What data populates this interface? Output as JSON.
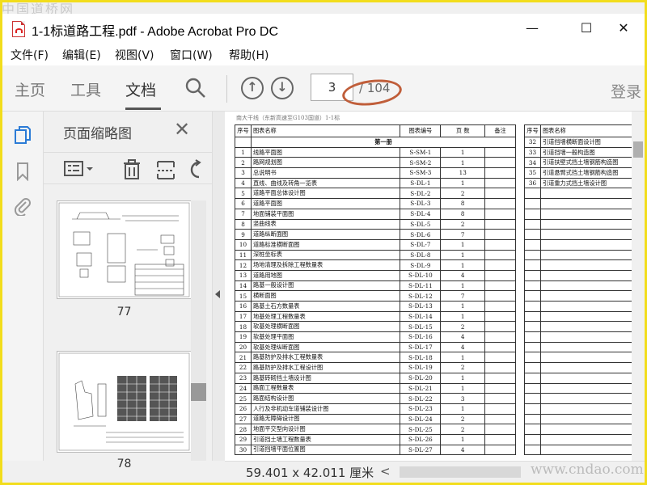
{
  "watermarks": {
    "top": "中国道桥网",
    "bottom": "www.cndao.com"
  },
  "window": {
    "title": "1-1标道路工程.pdf - Adobe Acrobat Pro DC",
    "minimize": "—",
    "maximize": "☐",
    "close": "✕"
  },
  "menu": [
    "文件(F)",
    "编辑(E)",
    "视图(V)",
    "窗口(W)",
    "帮助(H)"
  ],
  "toolbar": {
    "tabs": [
      "主页",
      "工具",
      "文档"
    ],
    "active_tab": "文档",
    "page_current": "3",
    "page_total": "/ 104",
    "login": "登录",
    "prev_icon": "arrow-up-icon",
    "next_icon": "arrow-down-icon",
    "search_icon": "search-icon"
  },
  "thumbnail_panel": {
    "title": "页面缩略图",
    "pages": [
      "77",
      "78"
    ]
  },
  "document": {
    "header": "南大干线（东新高速至G103国道）1-1标",
    "left_table": {
      "headers": [
        "序号",
        "图表名称",
        "图表编号",
        "页  数",
        "备注"
      ],
      "section": "第一册",
      "rows": [
        [
          "1",
          "线路平面图",
          "S-SM-1",
          "1",
          ""
        ],
        [
          "2",
          "路网规划图",
          "S-SM-2",
          "1",
          ""
        ],
        [
          "3",
          "总说明书",
          "S-SM-3",
          "13",
          ""
        ],
        [
          "4",
          "直线、曲线及转角一览表",
          "S-DL-1",
          "1",
          ""
        ],
        [
          "5",
          "道路平面总体设计图",
          "S-DL-2",
          "2",
          ""
        ],
        [
          "6",
          "道路平面图",
          "S-DL-3",
          "8",
          ""
        ],
        [
          "7",
          "地面铺装平面图",
          "S-DL-4",
          "8",
          ""
        ],
        [
          "8",
          "竖曲线表",
          "S-DL-5",
          "2",
          ""
        ],
        [
          "9",
          "道路纵断面图",
          "S-DL-6",
          "7",
          ""
        ],
        [
          "10",
          "道路标准横断面图",
          "S-DL-7",
          "1",
          ""
        ],
        [
          "11",
          "深桩坐标表",
          "S-DL-8",
          "1",
          ""
        ],
        [
          "12",
          "场地清理及拆除工程数量表",
          "S-DL-9",
          "1",
          ""
        ],
        [
          "13",
          "道路用地图",
          "S-DL-10",
          "4",
          ""
        ],
        [
          "14",
          "路基一般设计图",
          "S-DL-11",
          "1",
          ""
        ],
        [
          "15",
          "横断面图",
          "S-DL-12",
          "7",
          ""
        ],
        [
          "16",
          "路基土石方数量表",
          "S-DL-13",
          "1",
          ""
        ],
        [
          "17",
          "地基处理工程数量表",
          "S-DL-14",
          "1",
          ""
        ],
        [
          "18",
          "软基处理横断面图",
          "S-DL-15",
          "2",
          ""
        ],
        [
          "19",
          "软基处理平面图",
          "S-DL-16",
          "4",
          ""
        ],
        [
          "20",
          "软基处理纵断面图",
          "S-DL-17",
          "4",
          ""
        ],
        [
          "21",
          "路基防护及排水工程数量表",
          "S-DL-18",
          "1",
          ""
        ],
        [
          "22",
          "路基防护及排水工程设计图",
          "S-DL-19",
          "2",
          ""
        ],
        [
          "23",
          "路基砖砌挡土墙设计图",
          "S-DL-20",
          "1",
          ""
        ],
        [
          "24",
          "路面工程数量表",
          "S-DL-21",
          "1",
          ""
        ],
        [
          "25",
          "路面结构设计图",
          "S-DL-22",
          "3",
          ""
        ],
        [
          "26",
          "人行及非机动车道铺装设计图",
          "S-DL-23",
          "1",
          ""
        ],
        [
          "27",
          "道路无障碍设计图",
          "S-DL-24",
          "2",
          ""
        ],
        [
          "28",
          "地面平交型向设计图",
          "S-DL-25",
          "2",
          ""
        ],
        [
          "29",
          "引道挡土墙工程数量表",
          "S-DL-26",
          "1",
          ""
        ],
        [
          "30",
          "引道挡墙平面位置图",
          "S-DL-27",
          "4",
          ""
        ]
      ]
    },
    "right_table": {
      "headers": [
        "序号",
        "图表名称"
      ],
      "rows": [
        [
          "32",
          "引道挡墙横断面设计图"
        ],
        [
          "33",
          "引道挡墙一般构造图"
        ],
        [
          "34",
          "引道扶壁式挡土墙钢筋构造图"
        ],
        [
          "35",
          "引道悬臂式挡土墙钢筋构造图"
        ],
        [
          "36",
          "引道重力式挡土墙设计图"
        ]
      ]
    }
  },
  "status": {
    "dimensions": "59.401 x 42.011 厘米",
    "scroll_left": "<"
  }
}
